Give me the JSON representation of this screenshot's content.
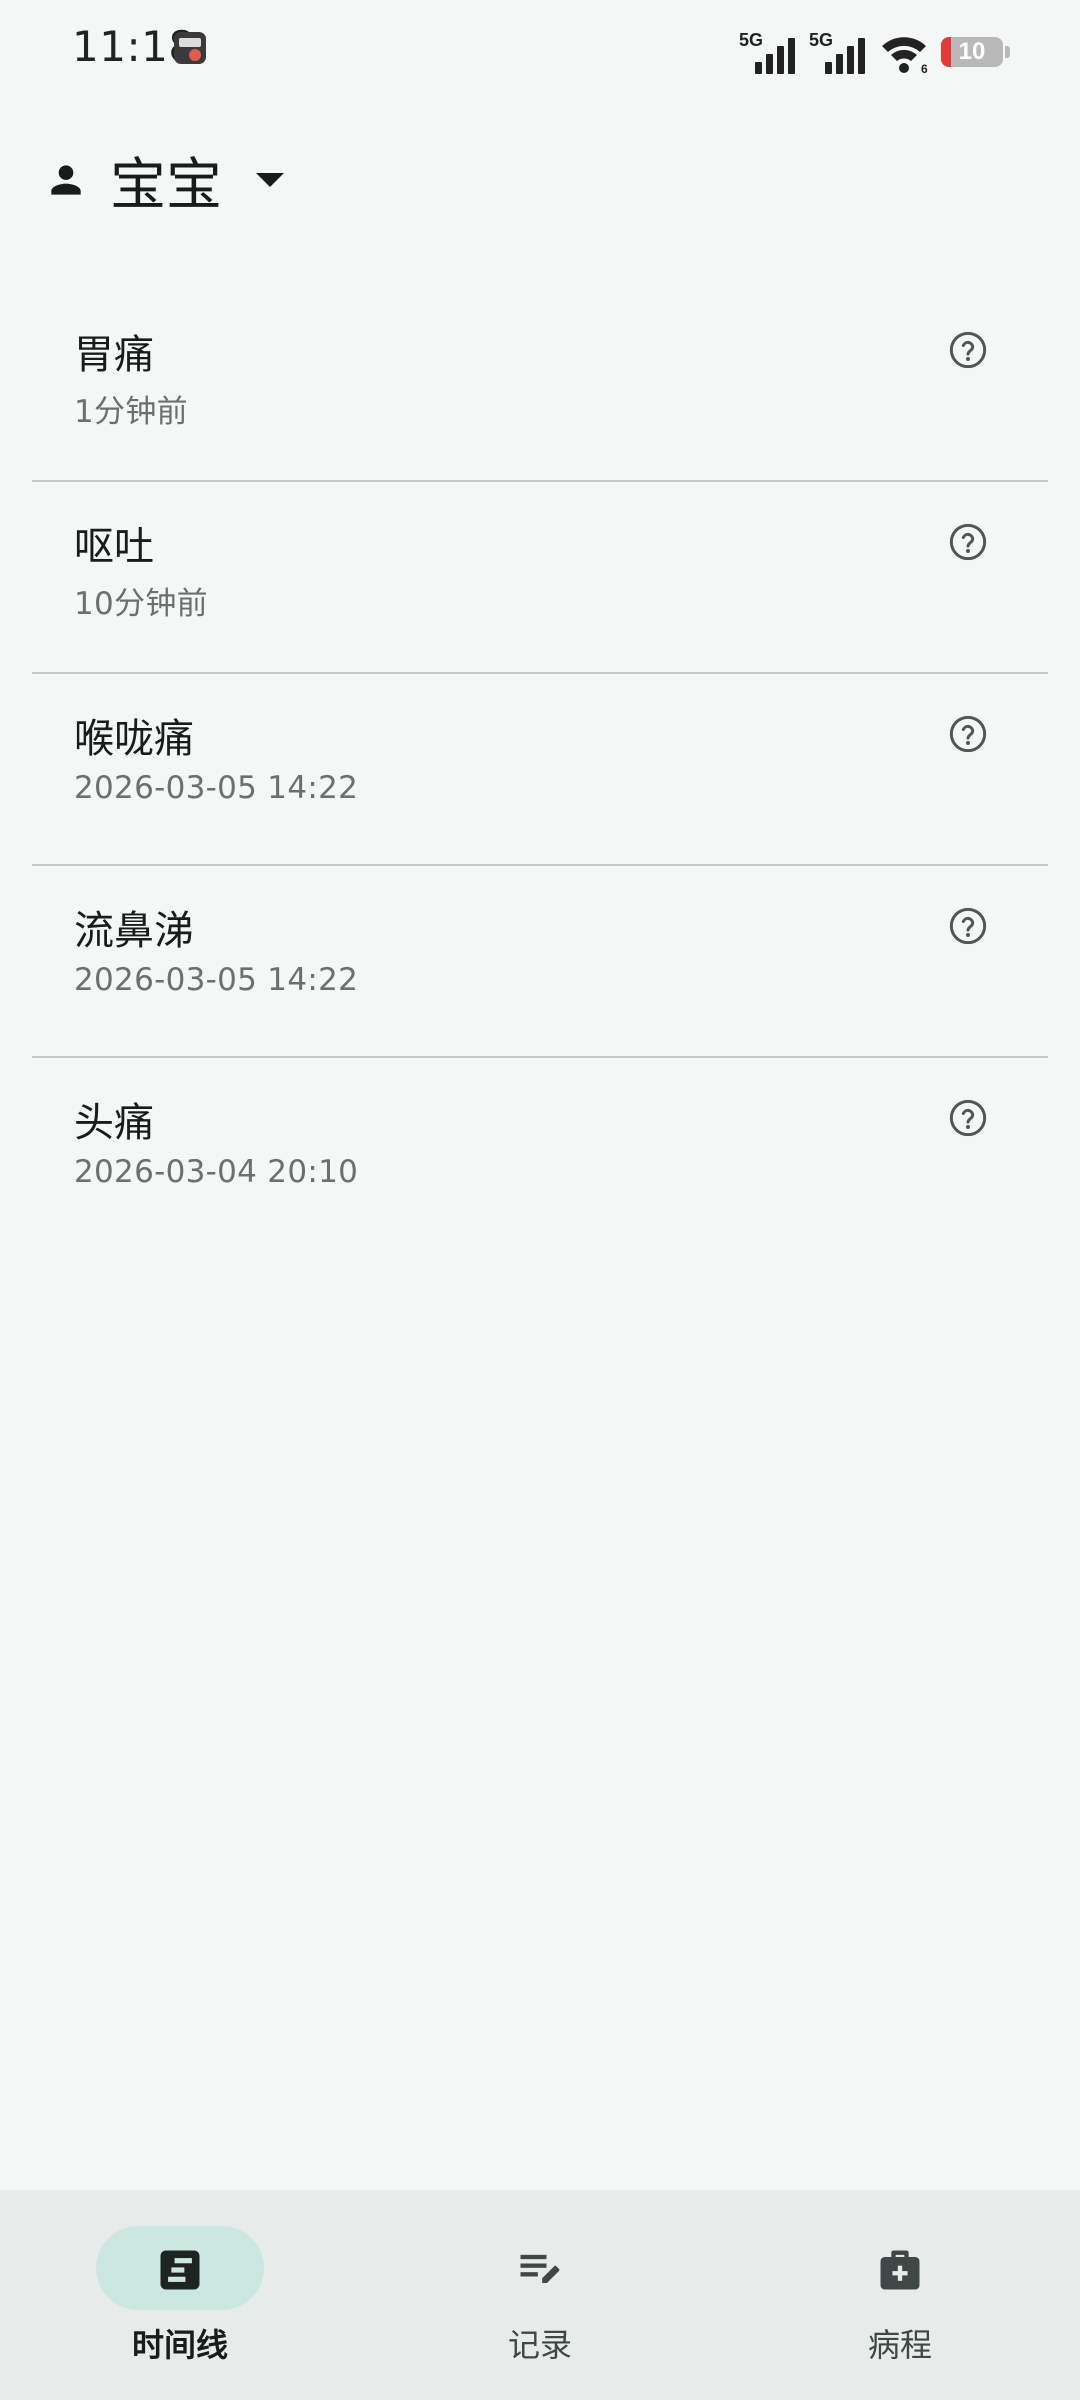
{
  "status_bar": {
    "time": "11:18",
    "signal1_label": "5G",
    "signal2_label": "5G",
    "wifi_badge": "6",
    "battery_level": "10"
  },
  "header": {
    "profile_name": "宝宝"
  },
  "symptoms": [
    {
      "title": "胃痛",
      "time": "1分钟前"
    },
    {
      "title": "呕吐",
      "time": "10分钟前"
    },
    {
      "title": "喉咙痛",
      "time": "2026-03-05 14:22"
    },
    {
      "title": "流鼻涕",
      "time": "2026-03-05 14:22"
    },
    {
      "title": "头痛",
      "time": "2026-03-04 20:10"
    }
  ],
  "bottom_nav": {
    "timeline_label": "时间线",
    "record_label": "记录",
    "course_label": "病程",
    "active": "timeline"
  },
  "colors": {
    "background": "#f3f8f6",
    "nav_background": "#e7ecea",
    "active_pill": "#cbe7e1",
    "divider": "#c4c9c7",
    "battery_low": "#e53935"
  }
}
